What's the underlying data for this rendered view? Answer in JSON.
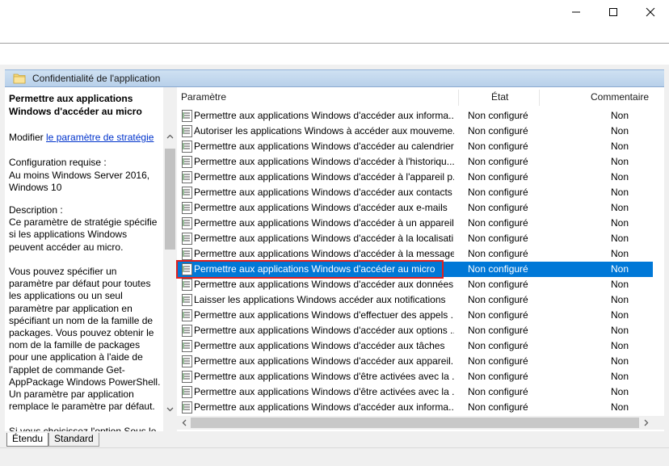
{
  "window": {
    "minimize_label": "—",
    "maximize_label": "☐",
    "close_label": "✕"
  },
  "header": {
    "folder_title": "Confidentialité de l'application"
  },
  "description": {
    "title": "Permettre aux applications Windows d'accéder au micro",
    "edit_prefix": "Modifier ",
    "edit_link": "le paramètre de stratégie",
    "requirements": "Configuration requise :\nAu moins Windows Server 2016, Windows 10",
    "body": "Description :\nCe paramètre de stratégie spécifie si les applications Windows peuvent accéder au micro.\n\nVous pouvez spécifier un paramètre par défaut pour toutes les applications ou un seul paramètre par application en spécifiant un nom de la famille de packages. Vous pouvez obtenir le nom de la famille de packages pour une application à l'aide de l'applet de commande Get-AppPackage Windows PowerShell. Un paramètre par application remplace le paramètre par défaut.\n\nSi vous choisissez l'option Sous le"
  },
  "columns": {
    "setting": "Paramètre",
    "state": "État",
    "comment": "Commentaire"
  },
  "rows": [
    {
      "name": "Permettre aux applications Windows d'accéder aux informa...",
      "state": "Non configuré",
      "comment": "Non"
    },
    {
      "name": "Autoriser les applications Windows à accéder aux mouveme...",
      "state": "Non configuré",
      "comment": "Non"
    },
    {
      "name": "Permettre aux applications Windows d'accéder au calendrier",
      "state": "Non configuré",
      "comment": "Non"
    },
    {
      "name": "Permettre aux applications Windows d'accéder à l'historiqu...",
      "state": "Non configuré",
      "comment": "Non"
    },
    {
      "name": "Permettre aux applications Windows d'accéder à l'appareil p...",
      "state": "Non configuré",
      "comment": "Non"
    },
    {
      "name": "Permettre aux applications Windows d'accéder aux contacts",
      "state": "Non configuré",
      "comment": "Non"
    },
    {
      "name": "Permettre aux applications Windows d'accéder aux e-mails",
      "state": "Non configuré",
      "comment": "Non"
    },
    {
      "name": "Permettre aux applications Windows d'accéder à un appareil...",
      "state": "Non configuré",
      "comment": "Non"
    },
    {
      "name": "Permettre aux applications Windows d'accéder à la localisati...",
      "state": "Non configuré",
      "comment": "Non"
    },
    {
      "name": "Permettre aux applications Windows d'accéder à la message...",
      "state": "Non configuré",
      "comment": "Non"
    },
    {
      "name": "Permettre aux applications Windows d'accéder au micro",
      "state": "Non configuré",
      "comment": "Non",
      "selected": true
    },
    {
      "name": "Permettre aux applications Windows d'accéder aux données...",
      "state": "Non configuré",
      "comment": "Non"
    },
    {
      "name": "Laisser les applications Windows accéder aux notifications",
      "state": "Non configuré",
      "comment": "Non"
    },
    {
      "name": "Permettre aux applications Windows d'effectuer des appels ...",
      "state": "Non configuré",
      "comment": "Non"
    },
    {
      "name": "Permettre aux applications Windows d'accéder aux options ...",
      "state": "Non configuré",
      "comment": "Non"
    },
    {
      "name": "Permettre aux applications Windows d'accéder aux tâches",
      "state": "Non configuré",
      "comment": "Non"
    },
    {
      "name": "Permettre aux applications Windows d'accéder aux appareil...",
      "state": "Non configuré",
      "comment": "Non"
    },
    {
      "name": "Permettre aux applications Windows d'être activées avec la ...",
      "state": "Non configuré",
      "comment": "Non"
    },
    {
      "name": "Permettre aux applications Windows d'être activées avec la ...",
      "state": "Non configuré",
      "comment": "Non"
    },
    {
      "name": "Permettre aux applications Windows d'accéder aux informa...",
      "state": "Non configuré",
      "comment": "Non"
    }
  ],
  "tabs": [
    {
      "label": "Étendu",
      "active": true
    },
    {
      "label": "Standard",
      "active": false
    }
  ],
  "colors": {
    "selection": "#0078d7",
    "highlight_box": "#e0201e",
    "link": "#0033cc"
  }
}
